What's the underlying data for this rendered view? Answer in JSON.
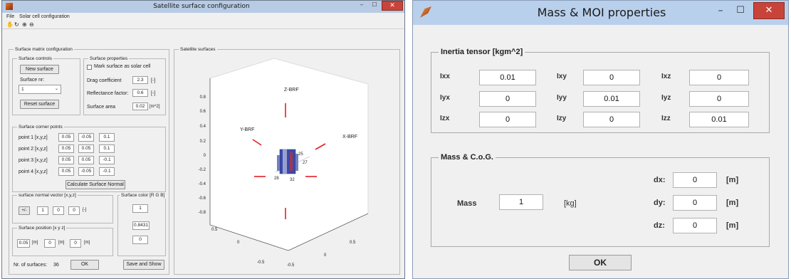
{
  "left_window": {
    "title": "Satellite surface configuration",
    "menu": [
      "File",
      "Solar cell configuration"
    ],
    "toolbar_icons": [
      "hand-icon",
      "rotate-icon",
      "zoom-in-icon",
      "zoom-out-icon"
    ],
    "surface_matrix_panel": {
      "title": "Surface matrix configuration",
      "surface_controls": {
        "title": "Surface controls",
        "new_surface_label": "New surface",
        "surface_nr_label": "Surface nr:",
        "surface_nr_value": "1",
        "reset_surface_label": "Reset surface"
      },
      "surface_properties": {
        "title": "Surface properties",
        "mark_solar_label": "Mark surface as solar cell",
        "drag_label": "Drag coefficient",
        "drag_value": "2.3",
        "drag_unit": "[-]",
        "reflectance_label": "Reflectance factor:",
        "reflectance_value": "0.6",
        "reflectance_unit": "[-]",
        "area_label": "Surface area",
        "area_value": "0.02",
        "area_unit": "[m^2]"
      },
      "corner_points": {
        "title": "Surface corner points",
        "rows": [
          {
            "label": "point 1 [x,y,z]",
            "values": [
              "0.05",
              "-0.05",
              "0.1"
            ]
          },
          {
            "label": "point 2 [x,y,z]",
            "values": [
              "0.05",
              "0.05",
              "0.1"
            ]
          },
          {
            "label": "point 3 [x,y,z]",
            "values": [
              "0.05",
              "0.05",
              "-0.1"
            ]
          },
          {
            "label": "point 4 [x,y,z]",
            "values": [
              "0.05",
              "-0.05",
              "-0.1"
            ]
          }
        ],
        "calc_label": "Calculate Surface Normal"
      },
      "normal_vector": {
        "title": "surface normal vector [x,y,z]",
        "flip_label": "+/-",
        "values": [
          "1",
          "0",
          "0"
        ],
        "unit": "[-]"
      },
      "position": {
        "title": "Surface position [x y z]",
        "values": [
          "0.05",
          "0",
          "0"
        ],
        "unit": "[m]"
      },
      "color": {
        "title": "Surface color [R G B]",
        "values": [
          "1",
          "0.8431",
          "0"
        ]
      },
      "nr_surfaces_label": "Nr. of surfaces:",
      "nr_surfaces_value": "36",
      "ok_label": "OK",
      "save_show_label": "Save and Show"
    },
    "plot_panel": {
      "title": "Satellite surfaces",
      "y_ticks": [
        "0.8",
        "0.6",
        "0.4",
        "0.2",
        "0",
        "-0.2",
        "-0.4",
        "-0.6",
        "-0.8"
      ],
      "x_ticks_left": [
        "0.5",
        "0",
        "-0.5"
      ],
      "x_ticks_right": [
        "0.5",
        "0",
        "-0.5"
      ],
      "axis_labels": [
        "Z-BRF",
        "Y-BRF",
        "X-BRF"
      ],
      "surface_numbers": [
        "25",
        "27",
        "28",
        "32"
      ]
    }
  },
  "right_window": {
    "title": "Mass & MOI properties",
    "inertia": {
      "title": "Inertia tensor [kgm^2]",
      "labels": [
        [
          "Ixx",
          "Ixy",
          "Ixz"
        ],
        [
          "Iyx",
          "Iyy",
          "Iyz"
        ],
        [
          "Izx",
          "Izy",
          "Izz"
        ]
      ],
      "values": [
        [
          "0.01",
          "0",
          "0"
        ],
        [
          "0",
          "0.01",
          "0"
        ],
        [
          "0",
          "0",
          "0.01"
        ]
      ]
    },
    "mass_cog": {
      "title": "Mass & C.o.G.",
      "mass_label": "Mass",
      "mass_value": "1",
      "mass_unit": "[kg]",
      "offsets": [
        {
          "label": "dx:",
          "value": "0",
          "unit": "[m]"
        },
        {
          "label": "dy:",
          "value": "0",
          "unit": "[m]"
        },
        {
          "label": "dz:",
          "value": "0",
          "unit": "[m]"
        }
      ]
    },
    "ok_label": "OK"
  },
  "colors": {
    "title_bar": "#b7cbe4",
    "window_bg": "#f0f0f0",
    "close_button": "#c8443a",
    "axis_marker": "#e0202a",
    "satellite_blue": "#3a4aa8"
  }
}
